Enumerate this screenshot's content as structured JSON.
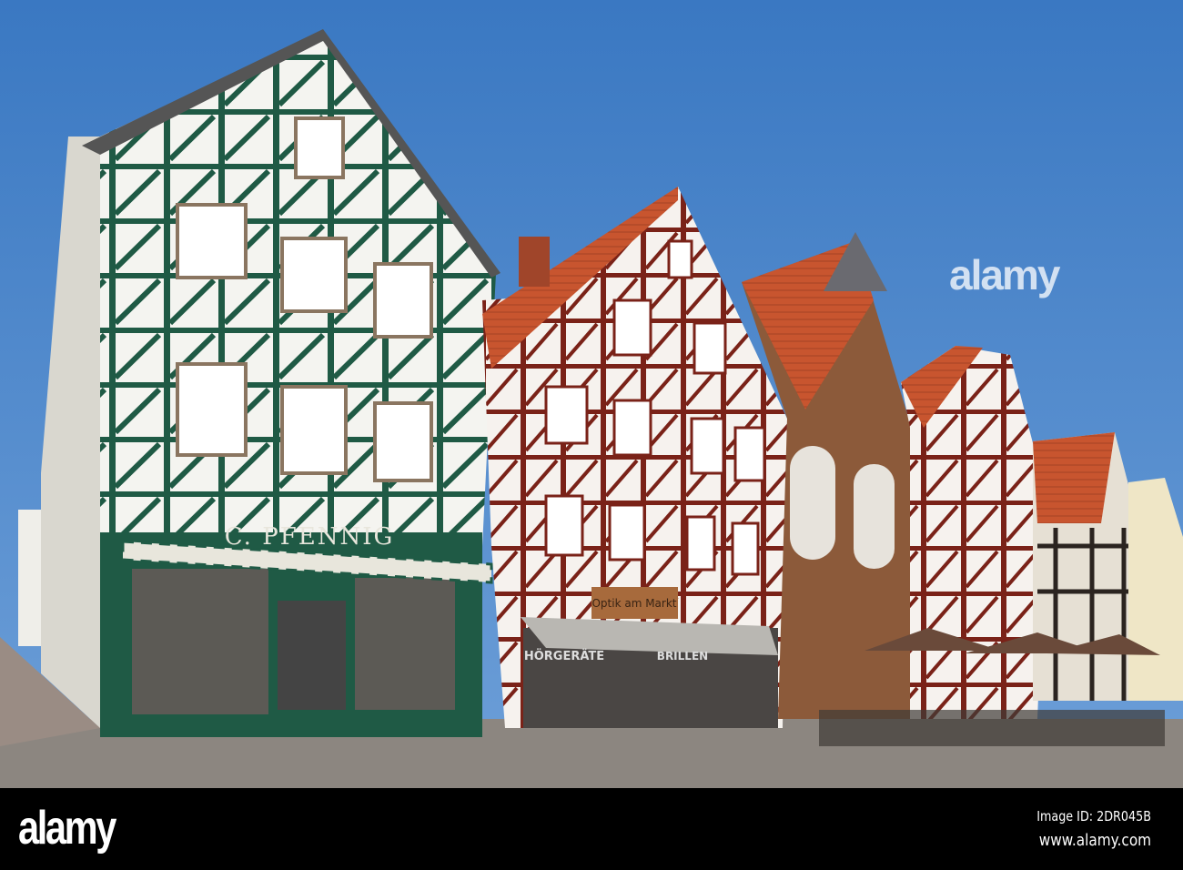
{
  "photo": {
    "shop_sign": "C. PFENNIG",
    "optician_sign": "Optik am Markt",
    "window_left": "HÖRGERÄTE",
    "window_right": "BRILLEN",
    "colors": {
      "sky": "#3f7fc6",
      "green_timber": "#1f5a45",
      "red_timber": "#7a2218",
      "roof": "#c8552f",
      "pavement": "#8c8680"
    }
  },
  "watermark": {
    "text": "alamy"
  },
  "footer": {
    "logo": "alamy",
    "image_id": "Image ID: 2DR045B",
    "url": "www.alamy.com"
  }
}
